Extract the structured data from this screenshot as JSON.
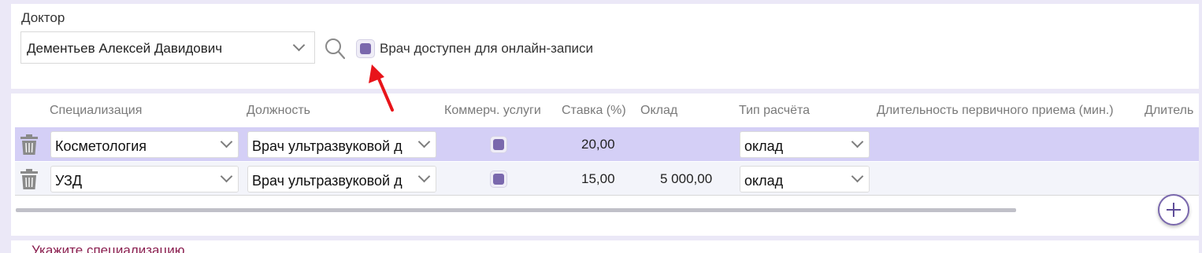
{
  "doctor": {
    "label": "Доктор",
    "selected": "Дементьев Алексей Давидович",
    "online_label": "Врач доступен для онлайн-записи",
    "online_checked": true
  },
  "table": {
    "columns": [
      "Специализация",
      "Должность",
      "Коммерч. услуги",
      "Ставка (%)",
      "Оклад",
      "Тип расчёта",
      "Длительность первичного приема (мин.)",
      "Длитель"
    ],
    "rows": [
      {
        "specialization": "Косметология",
        "position": "Врач ультразвуковой д",
        "commercial": true,
        "rate": "20,00",
        "salary": "",
        "calc_type": "оклад"
      },
      {
        "specialization": "УЗД",
        "position": "Врач ультразвуковой д",
        "commercial": true,
        "rate": "15,00",
        "salary": "5 000,00",
        "calc_type": "оклад"
      }
    ]
  },
  "hint": "Укажите специализацию",
  "colors": {
    "accent": "#7a68ad",
    "selected_row": "#d4cff6",
    "hint": "#8a1e4f",
    "arrow": "#e8141a"
  },
  "icons": [
    "search-icon",
    "trash-icon",
    "chevron-down-icon",
    "add-icon",
    "arrow-annotation"
  ]
}
